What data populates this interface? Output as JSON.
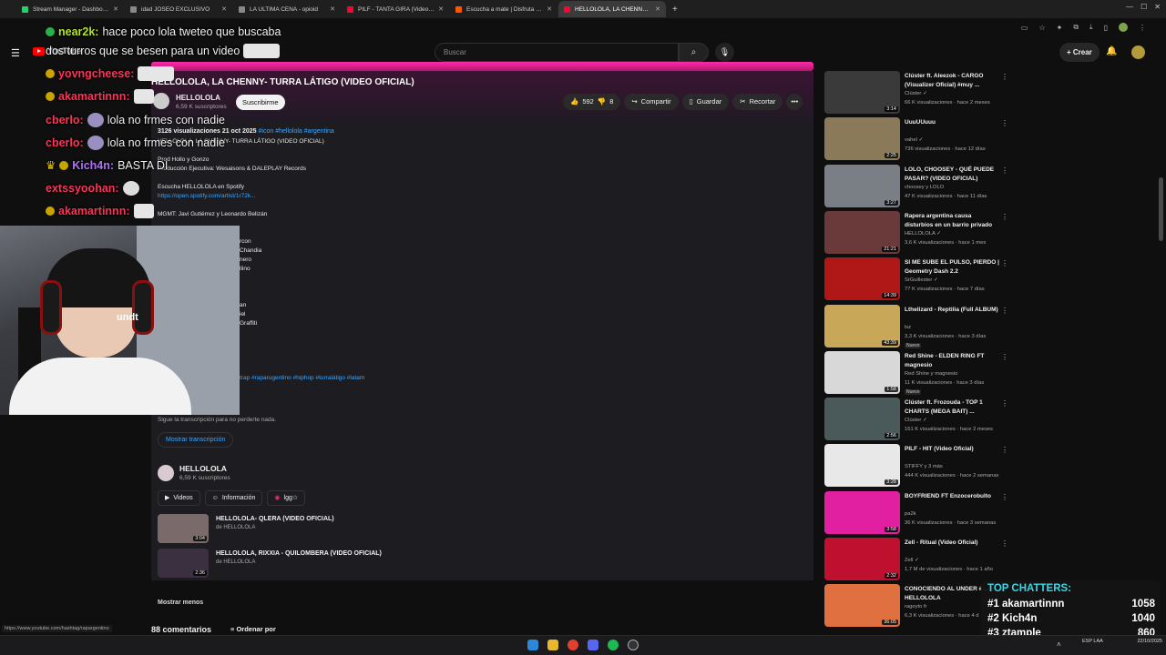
{
  "browser": {
    "tabs": [
      {
        "label": "Stream Manager - Dashboard",
        "color": "#2ecc71",
        "active": false
      },
      {
        "label": "idad JOSEO EXCLUSIVO",
        "color": "#888888",
        "active": false
      },
      {
        "label": "LA ULTIMA CENA - opioid",
        "color": "#888888",
        "active": false
      },
      {
        "label": "PILF - TANTA GIRA (Video Oficial)",
        "color": "#ff0033",
        "active": false
      },
      {
        "label": "Escucha a mate | Disfruta de la m",
        "color": "#ff5500",
        "active": false
      },
      {
        "label": "HELLOLOLA, LA CHENNY- TURRA L",
        "color": "#ff0033",
        "active": true
      }
    ],
    "new_tab_symbol": "+",
    "window_controls": [
      "—",
      "☐",
      "✕"
    ]
  },
  "youtube": {
    "logo_text": "YouTube",
    "search_placeholder": "Buscar",
    "create_label": "+ Crear"
  },
  "video": {
    "title": "HELLOLOLA, LA CHENNY- TURRA LÁTIGO (VIDEO OFICIAL)",
    "channel": "HELLOLOLA",
    "subscribers": "6,59 K suscriptores",
    "subscribe_label": "Suscribirme",
    "likes": "592",
    "dislikes": "8",
    "share_label": "Compartir",
    "save_label": "Guardar",
    "clip_label": "Recortar",
    "more_label": "•••"
  },
  "description": {
    "meta": "3126 visualizaciones  21 oct 2025",
    "tags_top": "#icon #hellolola #argentina",
    "lines": [
      "HELLOLOLA, LA CHENNY- TURRA LÁTIGO (VIDEO OFICIAL)",
      "Prod Hollo y Gonzo",
      "Producción Ejecutiva: Wesaisons & DALEPLAY Records",
      "Escucha HELLOLOLA en Spotify",
      "https://open.spotify.com/artist/1r72k...",
      "MGMT: Javi Gutiérrez y Leonardo Belizán",
      "rcon",
      "Chandia",
      "nero",
      "llino",
      "an",
      "iel",
      "Graffiti",
      "trap #raparugentino #hiphop #turralátigo #latam",
      "Sigue la transcripción para no perderte nada."
    ],
    "transcript_label": "Mostrar transcripción",
    "channel_name": "HELLOLOLA",
    "channel_subs": "6,59 K suscriptores",
    "videos_label": "Videos",
    "info_label": "Información",
    "ig_label": "lgg☆",
    "related": [
      {
        "title": "HELLOLOLA- QLERA (VIDEO OFICIAL)",
        "channel": "de HELLOLOLA",
        "duration": "3:04"
      },
      {
        "title": "HELLOLOLA, RIXXIA - QUILOMBERA (VIDEO OFICIAL)",
        "channel": "de HELLOLOLA",
        "duration": "2:36"
      }
    ],
    "show_less": "Mostrar menos",
    "comments": "88 comentarios",
    "sort_by": "Ordenar por",
    "status_url": "https://www.youtube.com/hashtag/rapargentino"
  },
  "sidebar": [
    {
      "title": "Clúster ft. Aleezok - CARGO (Visualizer Oficial) #muy ...",
      "channel": "Clúster ✓",
      "views": "66 K visualizaciones · hace 2 meses",
      "duration": "3:14",
      "color": "#3a3a3a",
      "badge": ""
    },
    {
      "title": "UuuUUuuu",
      "channel": "vahel ✓",
      "views": "736 visualizaciones · hace 12 días",
      "duration": "2:25",
      "color": "#8a7a5a",
      "badge": ""
    },
    {
      "title": "LOLO, CHOOSEY - QUÉ PUEDE PASAR? (VIDEO OFICIAL)",
      "channel": "choosey y LOLO",
      "views": "47 K visualizaciones · hace 11 días",
      "duration": "3:27",
      "color": "#7a7f86",
      "badge": ""
    },
    {
      "title": "Rapera argentina causa disturbios en un barrio privado",
      "channel": "HELLOLOLA ✓",
      "views": "3,6 K visualizaciones · hace 1 mes",
      "duration": "21:21",
      "color": "#6a3a3a",
      "badge": ""
    },
    {
      "title": "SI ME SUBE EL PULSO, PIERDO | Geometry Dash 2.2",
      "channel": "SrGuillester ✓",
      "views": "77 K visualizaciones · hace 7 días",
      "duration": "14:39",
      "color": "#b01818",
      "badge": ""
    },
    {
      "title": "Lthelizard - Reptilia (Full ALBUM)",
      "channel": "lsz",
      "views": "3,3 K visualizaciones · hace 3 días",
      "duration": "43:39",
      "color": "#c8a858",
      "badge": "Nuevo"
    },
    {
      "title": "Red Shine - ELDEN RING FT magnesio",
      "channel": "Red Shine y magnesio",
      "views": "11 K visualizaciones · hace 3 días",
      "duration": "1:58",
      "color": "#d8d8d8",
      "badge": "Nuevo"
    },
    {
      "title": "Clúster ft. Frozouda - TOP 1 CHARTS (MEGA BAIT) ...",
      "channel": "Clúster ✓",
      "views": "161 K visualizaciones · hace 2 meses",
      "duration": "2:56",
      "color": "#4a5a5a",
      "badge": ""
    },
    {
      "title": "PILF - HIT (Video Oficial)",
      "channel": "STIFFY y 3 más",
      "views": "444 K visualizaciones · hace 2 semanas",
      "duration": "3:28",
      "color": "#e8e8e8",
      "badge": ""
    },
    {
      "title": "BOYFRIEND FT Enzocerobulto",
      "channel": "pa2k",
      "views": "36 K visualizaciones · hace 3 semanas",
      "duration": "3:58",
      "color": "#e020a0",
      "badge": ""
    },
    {
      "title": "Zell - Ritual (Video Oficial)",
      "channel": "Zell ✓",
      "views": "1,7 M de visualizaciones · hace 1 año",
      "duration": "2:32",
      "color": "#c01030",
      "badge": ""
    },
    {
      "title": "CONOCIENDO AL UNDER #... HELLOLOLA",
      "channel": "rageyto fr",
      "views": "6,3 K visualizaciones · hace 4 d",
      "duration": "36:05",
      "color": "#e07040",
      "badge": ""
    }
  ],
  "chat": [
    {
      "nick": "near2k:",
      "text": "hace poco lola tweteo que buscaba",
      "nick_color": "#b5e61d"
    },
    {
      "nick": "",
      "text": "dos turros que se besen para un video",
      "nick_color": "#ffffff"
    },
    {
      "nick": "yovngcheese:",
      "text": "",
      "nick_color": "#ff3355"
    },
    {
      "nick": "akamartinnn:",
      "text": "",
      "nick_color": "#ff3355"
    },
    {
      "nick": "cberlo:",
      "text": "lola no frmes con nadie",
      "nick_color": "#ff3355"
    },
    {
      "nick": "cberlo:",
      "text": "lola no frmes con nadie",
      "nick_color": "#ff3355"
    },
    {
      "nick": "Kich4n:",
      "text": "BASTA DI",
      "nick_color": "#b070ff"
    },
    {
      "nick": "extssyoohan:",
      "text": "",
      "nick_color": "#ff3355"
    },
    {
      "nick": "akamartinnn:",
      "text": "",
      "nick_color": "#ff3355"
    }
  ],
  "webcam": {
    "hat_text": "undt"
  },
  "top_chatters": {
    "title": "TOP CHATTERS:",
    "rows": [
      {
        "rank": "#1",
        "name": "akamartinnn",
        "score": "1058"
      },
      {
        "rank": "#2",
        "name": "Kich4n",
        "score": "1040"
      },
      {
        "rank": "#3",
        "name": "ztample",
        "score": "860"
      }
    ]
  },
  "taskbar": {
    "lang": "ESP LAA",
    "time": "22/10/2025"
  }
}
